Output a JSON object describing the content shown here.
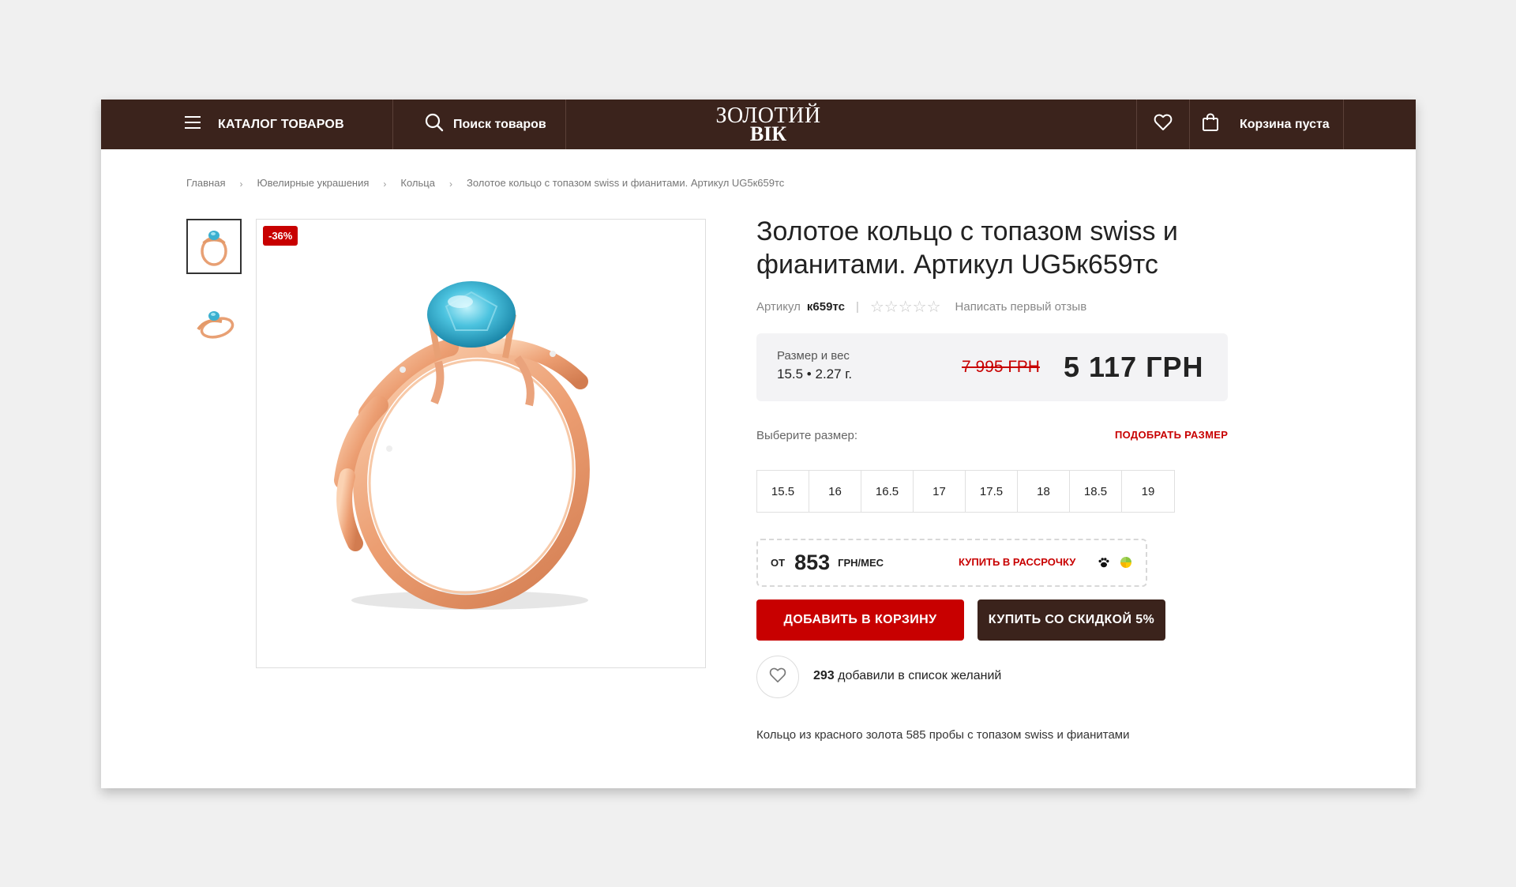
{
  "header": {
    "catalog_label": "КАТАЛОГ ТОВАРОВ",
    "search_label": "Поиск товаров",
    "logo_line1": "ЗОЛОТИЙ",
    "logo_line2": "ВІК",
    "cart_label": "Корзина пуста",
    "icons": [
      "menu-icon",
      "search-icon",
      "heart-icon",
      "shopping-bag-icon"
    ]
  },
  "breadcrumbs": [
    {
      "label": "Главная"
    },
    {
      "label": "Ювелирные украшения"
    },
    {
      "label": "Кольца"
    },
    {
      "label": "Золотое кольцо с топазом swiss и фианитами. Артикул UG5к659тс"
    }
  ],
  "gallery": {
    "badge": "-36%"
  },
  "product": {
    "title": "Золотое кольцо с топазом swiss и фианитами. Артикул UG5к659тс",
    "sku_label": "Артикул",
    "sku_value": "к659тс",
    "separator": "|",
    "stars": "☆☆☆☆☆",
    "rating": 0,
    "review_link": "Написать первый отзыв",
    "size_weight_label": "Размер и вес",
    "size_weight_value": "15.5 • 2.27 г.",
    "old_price": "7 995 ГРН",
    "new_price": "5 117 ГРН",
    "choose_size_label": "Выберите размер:",
    "pick_size_link": "ПОДОБРАТЬ РАЗМЕР",
    "sizes": [
      "15.5",
      "16",
      "16.5",
      "17",
      "17.5",
      "18",
      "18.5",
      "19"
    ],
    "credit": {
      "from": "ОТ",
      "amount": "853",
      "unit": "ГРН/МЕС",
      "link": "КУПИТЬ В РАССРОЧКУ"
    },
    "add_to_cart": "ДОБАВИТЬ В КОРЗИНУ",
    "buy_discount": "КУПИТЬ СО СКИДКОЙ 5%",
    "wishlist_count": "293",
    "wishlist_text": "добавили в список желаний",
    "description": "Кольцо из красного золота 585 пробы с топазом swiss и фианитами"
  },
  "colors": {
    "header_bg": "#3b231c",
    "accent_red": "#c80000",
    "price_box_bg": "#f3f3f5"
  }
}
